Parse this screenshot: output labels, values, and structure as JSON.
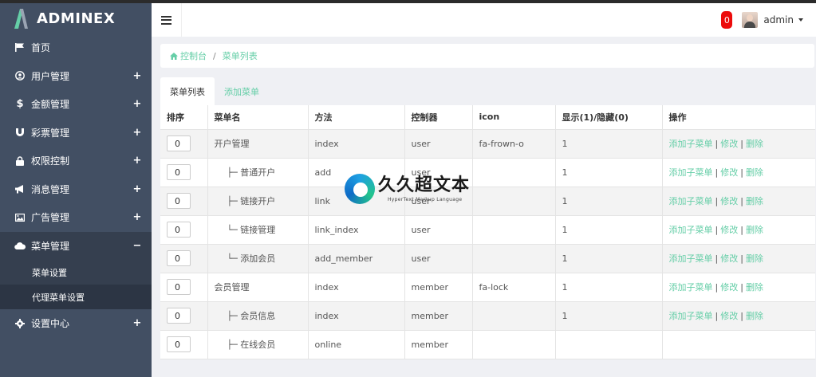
{
  "app": {
    "logo_text": "ADMINEX",
    "accent": "#65cea7",
    "sidebar_bg": "#424f63"
  },
  "sidebar": {
    "items": [
      {
        "label": "首页",
        "icon": "flag-icon",
        "expandable": false
      },
      {
        "label": "用户管理",
        "icon": "user-circle-icon",
        "expandable": true
      },
      {
        "label": "金额管理",
        "icon": "dollar-icon",
        "expandable": true
      },
      {
        "label": "彩票管理",
        "icon": "magnet-icon",
        "expandable": true
      },
      {
        "label": "权限控制",
        "icon": "lock-icon",
        "expandable": true
      },
      {
        "label": "消息管理",
        "icon": "bullhorn-icon",
        "expandable": true
      },
      {
        "label": "广告管理",
        "icon": "picture-icon",
        "expandable": true
      },
      {
        "label": "菜单管理",
        "icon": "cloud-icon",
        "expandable": true,
        "expanded": true
      },
      {
        "label": "设置中心",
        "icon": "gear-icon",
        "expandable": true
      }
    ],
    "plus": "+",
    "minus": "−",
    "submenu": [
      {
        "label": "菜单设置"
      },
      {
        "label": "代理菜单设置"
      }
    ]
  },
  "header": {
    "notification_count": "0",
    "user_name": "admin"
  },
  "breadcrumb": {
    "home": "控制台",
    "separator": "/",
    "current": "菜单列表"
  },
  "tabs": [
    {
      "label": "菜单列表",
      "active": true
    },
    {
      "label": "添加菜单",
      "active": false
    }
  ],
  "table": {
    "columns": [
      "排序",
      "菜单名",
      "方法",
      "控制器",
      "icon",
      "显示(1)/隐藏(0)",
      "操作"
    ],
    "rows": [
      {
        "sort": "0",
        "name": "开户管理",
        "method": "index",
        "controller": "user",
        "icon": "fa-frown-o",
        "show": "1"
      },
      {
        "sort": "0",
        "name": "├─ 普通开户",
        "method": "add",
        "controller": "user",
        "icon": "",
        "show": "1"
      },
      {
        "sort": "0",
        "name": "├─ 链接开户",
        "method": "link",
        "controller": "user",
        "icon": "",
        "show": "1"
      },
      {
        "sort": "0",
        "name": "└─ 链接管理",
        "method": "link_index",
        "controller": "user",
        "icon": "",
        "show": "1"
      },
      {
        "sort": "0",
        "name": "└─ 添加会员",
        "method": "add_member",
        "controller": "user",
        "icon": "",
        "show": "1"
      },
      {
        "sort": "0",
        "name": "会员管理",
        "method": "index",
        "controller": "member",
        "icon": "fa-lock",
        "show": "1"
      },
      {
        "sort": "0",
        "name": "├─ 会员信息",
        "method": "index",
        "controller": "member",
        "icon": "",
        "show": "1"
      },
      {
        "sort": "0",
        "name": "├─ 在线会员",
        "method": "online",
        "controller": "member",
        "icon": "",
        "show": ""
      }
    ],
    "ops": {
      "add_child": "添加子菜单",
      "edit": "修改",
      "delete": "删除",
      "separator": "|"
    },
    "ops_rows": 7
  },
  "watermark": {
    "title": "久久超文本",
    "subtitle": "HyperText Markup Language"
  }
}
